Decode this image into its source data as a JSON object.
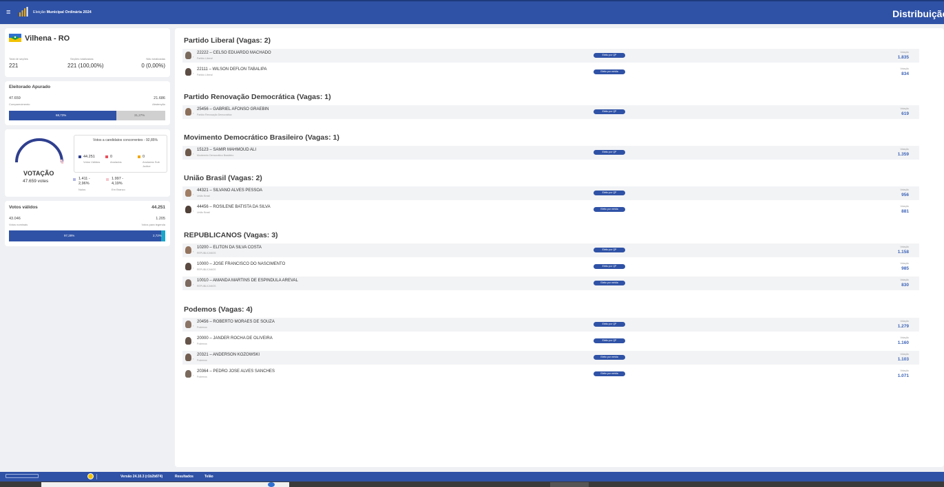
{
  "header": {
    "menu_icon": "hamburger-icon",
    "title_prefix": "Eleição",
    "title_bold": "Municipal Ordinária 2024",
    "right_title": "Distribuição"
  },
  "summary": {
    "city": "Vilhena - RO",
    "flag_icon": "state-flag-icon",
    "total_secoes_label": "Total de seções",
    "total_secoes": "221",
    "secoes_totalizadas_label": "Seções totalizadas",
    "secoes_totalizadas": "221 (100,00%)",
    "nao_totalizadas_label": "Não totalizadas",
    "nao_totalizadas": "0 (0,00%)"
  },
  "eleitorado": {
    "title": "Eleitorado Apurado",
    "comparecimento": "47.659",
    "comparecimento_label": "Comparecimento",
    "abstencao": "21.686",
    "abstencao_label": "Abstenção",
    "pct_comparecimento": "68,73%",
    "pct_abstencao": "31,27%",
    "fraction_comparecimento": 0.6873
  },
  "votacao": {
    "title": "VOTAÇÃO",
    "votes": "47.659 votes",
    "box_title": "Votos a candidatos concorrentes - 92,85%",
    "validos": "44.251",
    "validos_label": "Votos Válidos",
    "anulados": "0",
    "anulados_label": "Anulados",
    "anulados_sub": "0",
    "anulados_sub_label": "Anulados Sub Judice",
    "nulos": "1.411 - 2,96%",
    "nulos_label": "Nulos",
    "brancos": "1.997 - 4,19%",
    "brancos_label": "Em Branco",
    "colors": {
      "validos": "#2f3f8f",
      "anulados": "#e8505b",
      "anulados_sub": "#f2a900",
      "nulos": "#b3b6e0",
      "brancos": "#f5c6cc"
    }
  },
  "validos": {
    "title": "Votos válidos",
    "total": "44.251",
    "nominais": "43.046",
    "nominais_label": "Votos nominais",
    "legenda": "1.205",
    "legenda_label": "Votos para legenda",
    "pct_nominais": "97,28%",
    "pct_legenda": "2,72%",
    "fraction_nominais": 0.9728
  },
  "parties": [
    {
      "title": "Partido Liberal (Vagas: 2)",
      "candidates": [
        {
          "name": "22222 – CELSO EDUARDO MACHADO",
          "party": "Partido Liberal",
          "badge": "Eleito por QP",
          "vlabel": "Votação",
          "votes": "1.835"
        },
        {
          "name": "22111 – WILSON DEFLON TABALIPA",
          "party": "Partido Liberal",
          "badge": "Eleito por média",
          "vlabel": "Votação",
          "votes": "834"
        }
      ]
    },
    {
      "title": "Partido Renovação Democrática (Vagas: 1)",
      "candidates": [
        {
          "name": "25456 – GABRIEL AFONSO GRAEBIN",
          "party": "Partido Renovação Democrática",
          "badge": "Eleito por QP",
          "vlabel": "Votação",
          "votes": "619"
        }
      ]
    },
    {
      "title": "Movimento Democrático Brasileiro (Vagas: 1)",
      "candidates": [
        {
          "name": "15123 – SAMIR MAHMOUD ALI",
          "party": "Movimento Democrático Brasileiro",
          "badge": "Eleito por QP",
          "vlabel": "Votação",
          "votes": "1.359"
        }
      ]
    },
    {
      "title": "União Brasil (Vagas: 2)",
      "candidates": [
        {
          "name": "44321 – SILVANO ALVES PESSOA",
          "party": "União Brasil",
          "badge": "Eleito por QP",
          "vlabel": "Votação",
          "votes": "956"
        },
        {
          "name": "44456 – ROSILENE BATISTA DA SILVA",
          "party": "União Brasil",
          "badge": "Eleito por média",
          "vlabel": "Votação",
          "votes": "881"
        }
      ]
    },
    {
      "title": "REPUBLICANOS (Vagas: 3)",
      "candidates": [
        {
          "name": "10200 – ELITON DA SILVA COSTA",
          "party": "REPUBLICANOS",
          "badge": "Eleito por QP",
          "vlabel": "Votação",
          "votes": "1.158"
        },
        {
          "name": "10000 – JOSE FRANCISCO DO NASCIMENTO",
          "party": "REPUBLICANOS",
          "badge": "Eleito por QP",
          "vlabel": "Votação",
          "votes": "985"
        },
        {
          "name": "10010 – AMANDA MARTINS DE ESPINDULA AREVAL",
          "party": "REPUBLICANOS",
          "badge": "Eleito por média",
          "vlabel": "Votação",
          "votes": "830"
        }
      ]
    },
    {
      "title": "Podemos (Vagas: 4)",
      "candidates": [
        {
          "name": "20456 – ROBERTO MORAES DE SOUZA",
          "party": "Podemos",
          "badge": "Eleito por QP",
          "vlabel": "Votação",
          "votes": "1.279"
        },
        {
          "name": "20000 – JANDER ROCHA DE OLIVEIRA",
          "party": "Podemos",
          "badge": "Eleito por QP",
          "vlabel": "Votação",
          "votes": "1.160"
        },
        {
          "name": "20321 – ANDERSON KOZOWSKI",
          "party": "Podemos",
          "badge": "Eleito por média",
          "vlabel": "Votação",
          "votes": "1.103"
        },
        {
          "name": "20364 – PEDRO JOSE ALVES SANCHES",
          "party": "Podemos",
          "badge": "Eleito por média",
          "vlabel": "Votação",
          "votes": "1.071"
        }
      ]
    }
  ],
  "footer": {
    "version": "Versão 24.10.3 (r1b2b874)",
    "resultados": "Resultados",
    "telao": "Telão"
  },
  "colors": {
    "primary": "#2f52a6",
    "validos_bar": "#2f3f8f",
    "legenda_bar": "#1aa6c8",
    "abstencao_bar": "#d0d0d0"
  }
}
